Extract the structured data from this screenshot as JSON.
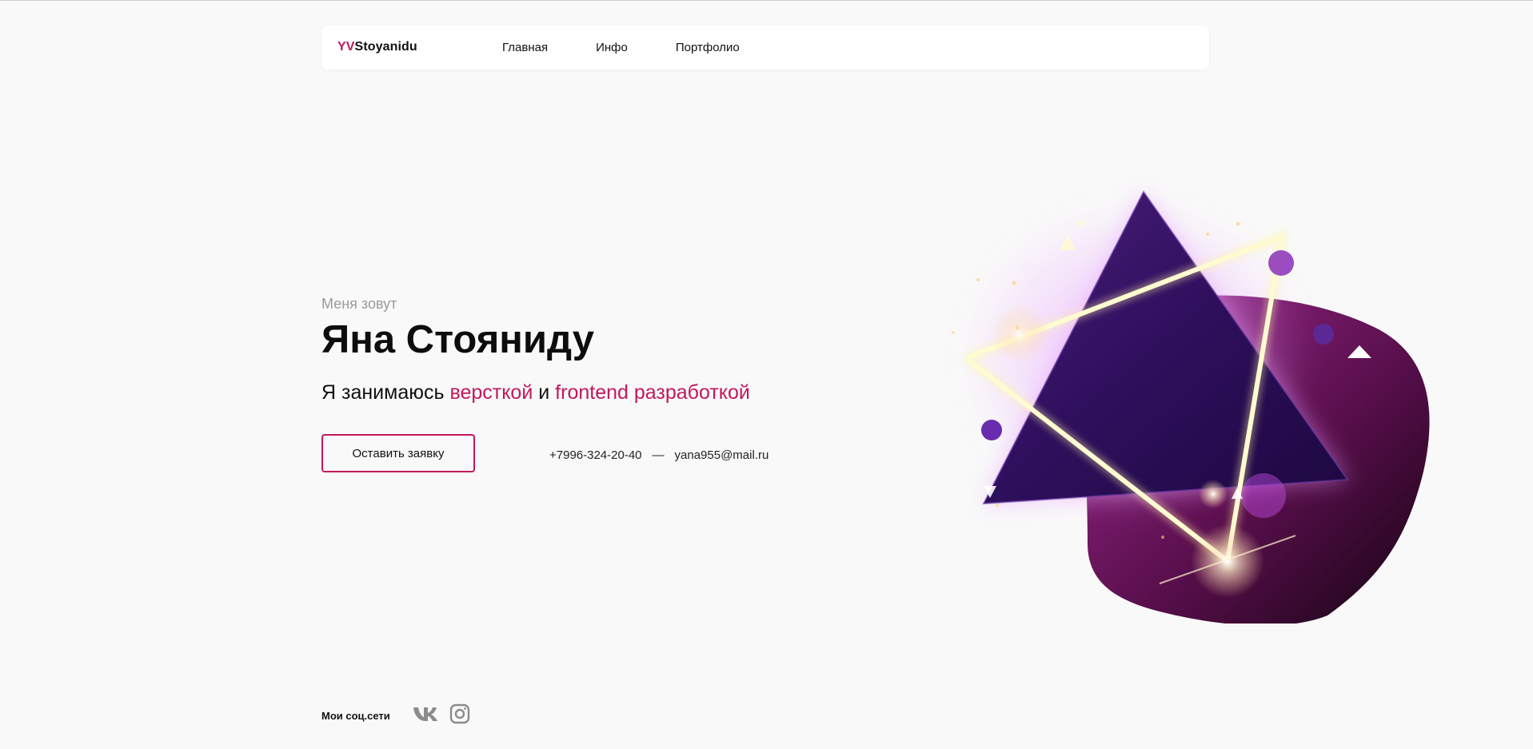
{
  "nav": {
    "logo_accent": "YV",
    "logo_rest": "Stoyanidu",
    "links": [
      "Главная",
      "Инфо",
      "Портфолио"
    ]
  },
  "hero": {
    "intro": "Меня зовут",
    "name": "Яна Стояниду",
    "tagline_1": "Я занимаюсь ",
    "tagline_pink_1": "версткой",
    "tagline_2": " и ",
    "tagline_pink_2": "frontend разработкой",
    "cta_label": "Оставить заявку"
  },
  "contacts": {
    "phone": "+7996-324-20-40",
    "separator": "—",
    "email": "yana955@mail.ru"
  },
  "social": {
    "label": "Мои соц.сети",
    "icons": [
      "vk-icon",
      "instagram-icon"
    ]
  },
  "colors": {
    "accent": "#c2185b",
    "background": "#f9f9f9"
  }
}
